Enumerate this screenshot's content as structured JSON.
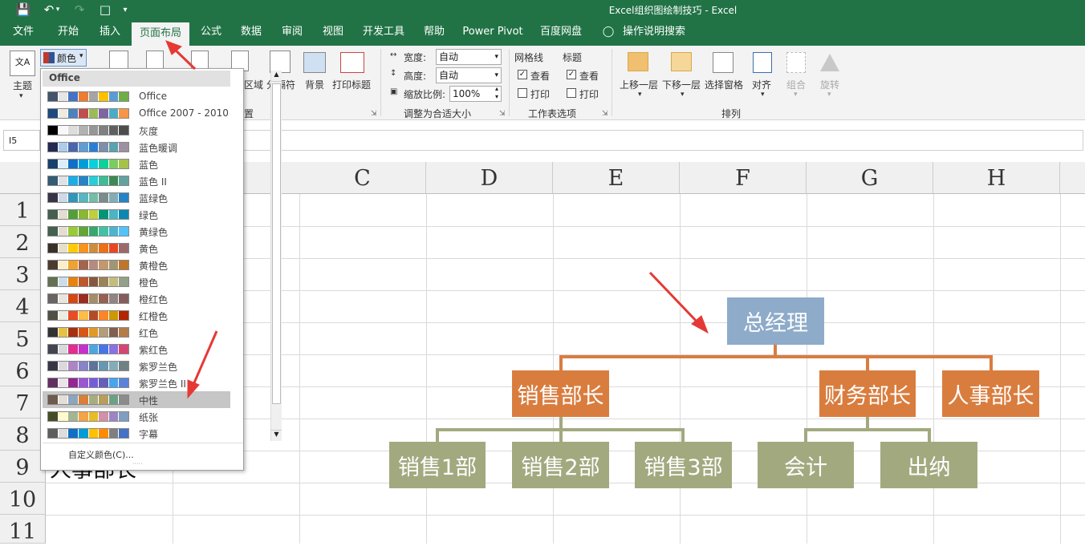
{
  "window": {
    "title": "Excel组织图绘制技巧 - Excel"
  },
  "tabs": [
    "文件",
    "开始",
    "插入",
    "页面布局",
    "公式",
    "数据",
    "审阅",
    "视图",
    "开发工具",
    "帮助",
    "Power Pivot",
    "百度网盘",
    "操作说明搜索"
  ],
  "ribbon": {
    "theme_label": "主题",
    "colors_button": "颜色",
    "area_label": "区域",
    "breaks_label": "分隔符",
    "background_label": "背景",
    "print_titles_label": "打印标题",
    "page_setup_group": "置",
    "width_label": "宽度:",
    "width_value": "自动",
    "height_label": "高度:",
    "height_value": "自动",
    "scale_label": "缩放比例:",
    "scale_value": "100%",
    "scale_group": "调整为合适大小",
    "gridlines_label": "网格线",
    "headings_label": "标题",
    "view_label": "查看",
    "print_label": "打印",
    "sheet_options_group": "工作表选项",
    "bring_forward": "上移一层",
    "send_backward": "下移一层",
    "selection_pane": "选择窗格",
    "align": "对齐",
    "group": "组合",
    "rotate": "旋转",
    "arrange_group": "排列"
  },
  "namebox": "I5",
  "columns": [
    "C",
    "D",
    "E",
    "F",
    "G",
    "H"
  ],
  "rows": [
    "1",
    "2",
    "3",
    "4",
    "5",
    "6",
    "7",
    "8",
    "9",
    "10",
    "11"
  ],
  "cell_text": "人事部长",
  "dropdown": {
    "header": "Office",
    "items": [
      {
        "label": "Office",
        "colors": [
          "#44546a",
          "#e7e6e6",
          "#4472c4",
          "#ed7d31",
          "#a5a5a5",
          "#ffc000",
          "#5b9bd5",
          "#70ad47"
        ]
      },
      {
        "label": "Office 2007 - 2010",
        "colors": [
          "#1f497d",
          "#eeece1",
          "#4f81bd",
          "#c0504d",
          "#9bbb59",
          "#8064a2",
          "#4bacc6",
          "#f79646"
        ]
      },
      {
        "label": "灰度",
        "colors": [
          "#000000",
          "#f8f8f8",
          "#dddddd",
          "#b2b2b2",
          "#969696",
          "#808080",
          "#5f5f5f",
          "#4d4d4d"
        ]
      },
      {
        "label": "蓝色暖调",
        "colors": [
          "#242852",
          "#acccea",
          "#4a66ac",
          "#629dd1",
          "#297fd5",
          "#7f8fa9",
          "#5aa2ae",
          "#9d90a0"
        ]
      },
      {
        "label": "蓝色",
        "colors": [
          "#17406d",
          "#dbeff9",
          "#0f6fc6",
          "#009dd9",
          "#0bd0d9",
          "#10cf9b",
          "#7cca62",
          "#a5c249"
        ]
      },
      {
        "label": "蓝色 II",
        "colors": [
          "#335b74",
          "#dfe3e5",
          "#1cade4",
          "#2683c6",
          "#27ced7",
          "#42ba97",
          "#3e8853",
          "#62a39f"
        ]
      },
      {
        "label": "蓝绿色",
        "colors": [
          "#373545",
          "#cedbe6",
          "#3494ba",
          "#58b6c0",
          "#75bda7",
          "#7a8c8e",
          "#84acb6",
          "#2683c6"
        ]
      },
      {
        "label": "绿色",
        "colors": [
          "#455f51",
          "#e3ded1",
          "#549e39",
          "#8ab833",
          "#c0cf3a",
          "#029676",
          "#4ab5c4",
          "#0989b1"
        ]
      },
      {
        "label": "黄绿色",
        "colors": [
          "#455f51",
          "#e3ded1",
          "#99cb38",
          "#63a537",
          "#37a76f",
          "#44c1a3",
          "#4eb3cf",
          "#51c3f9"
        ]
      },
      {
        "label": "黄色",
        "colors": [
          "#39302a",
          "#e5dec9",
          "#ffca08",
          "#f8931d",
          "#ce8d3e",
          "#ec7016",
          "#e64823",
          "#9c6a6a"
        ]
      },
      {
        "label": "黄橙色",
        "colors": [
          "#4e3b30",
          "#fbeec9",
          "#f0a22e",
          "#a5644e",
          "#b58b80",
          "#c3986d",
          "#a19574",
          "#c17529"
        ]
      },
      {
        "label": "橙色",
        "colors": [
          "#637052",
          "#ccddea",
          "#e48312",
          "#bd582c",
          "#865640",
          "#9b8357",
          "#c2bc80",
          "#94a088"
        ]
      },
      {
        "label": "橙红色",
        "colors": [
          "#696464",
          "#e9e5dc",
          "#d34817",
          "#9b2d1f",
          "#a28e6a",
          "#956251",
          "#918485",
          "#855d5d"
        ]
      },
      {
        "label": "红橙色",
        "colors": [
          "#505046",
          "#eeece1",
          "#e84c22",
          "#ffbd47",
          "#b64926",
          "#ff8427",
          "#cc9900",
          "#b22600"
        ]
      },
      {
        "label": "红色",
        "colors": [
          "#323232",
          "#e5c243",
          "#a5300f",
          "#d55816",
          "#e19825",
          "#b19c7d",
          "#7f5f52",
          "#b27d49"
        ]
      },
      {
        "label": "紫红色",
        "colors": [
          "#454551",
          "#d8d9dc",
          "#e32d91",
          "#c830cc",
          "#4ea6dc",
          "#4775e7",
          "#8971e1",
          "#d54773"
        ]
      },
      {
        "label": "紫罗兰色",
        "colors": [
          "#373545",
          "#dcd8dc",
          "#ad84c6",
          "#8784c7",
          "#5d739a",
          "#6997af",
          "#84acb6",
          "#6f8183"
        ]
      },
      {
        "label": "紫罗兰色 II",
        "colors": [
          "#632e62",
          "#eae5eb",
          "#92278f",
          "#9b57d3",
          "#755dd9",
          "#665eb8",
          "#45a5ed",
          "#5982db"
        ]
      },
      {
        "label": "中性",
        "colors": [
          "#6e5a4e",
          "#e3dfd6",
          "#8da5bf",
          "#d8803a",
          "#a7ad82",
          "#b89e5b",
          "#6e9f87",
          "#8c8c8c"
        ]
      },
      {
        "label": "纸张",
        "colors": [
          "#444d26",
          "#fefac9",
          "#a5b592",
          "#f3a447",
          "#e7bc29",
          "#d092a7",
          "#9c85c0",
          "#809ec2"
        ]
      },
      {
        "label": "字幕",
        "colors": [
          "#5e5e5e",
          "#ddddde",
          "#0f6fc6",
          "#009dd9",
          "#ffc000",
          "#ff8c00",
          "#7f7f7f",
          "#4472c4"
        ]
      }
    ],
    "custom": "自定义颜色(C)..."
  },
  "org": {
    "ceo": "总经理",
    "sales_head": "销售部长",
    "finance_head": "财务部长",
    "hr_head": "人事部长",
    "sales1": "销售1部",
    "sales2": "销售2部",
    "sales3": "销售3部",
    "accounting": "会计",
    "cashier": "出纳"
  },
  "colors": {
    "top": "#8eabc9",
    "mid": "#d97d3f",
    "leaf": "#a2a97f",
    "accent": "#217346"
  }
}
